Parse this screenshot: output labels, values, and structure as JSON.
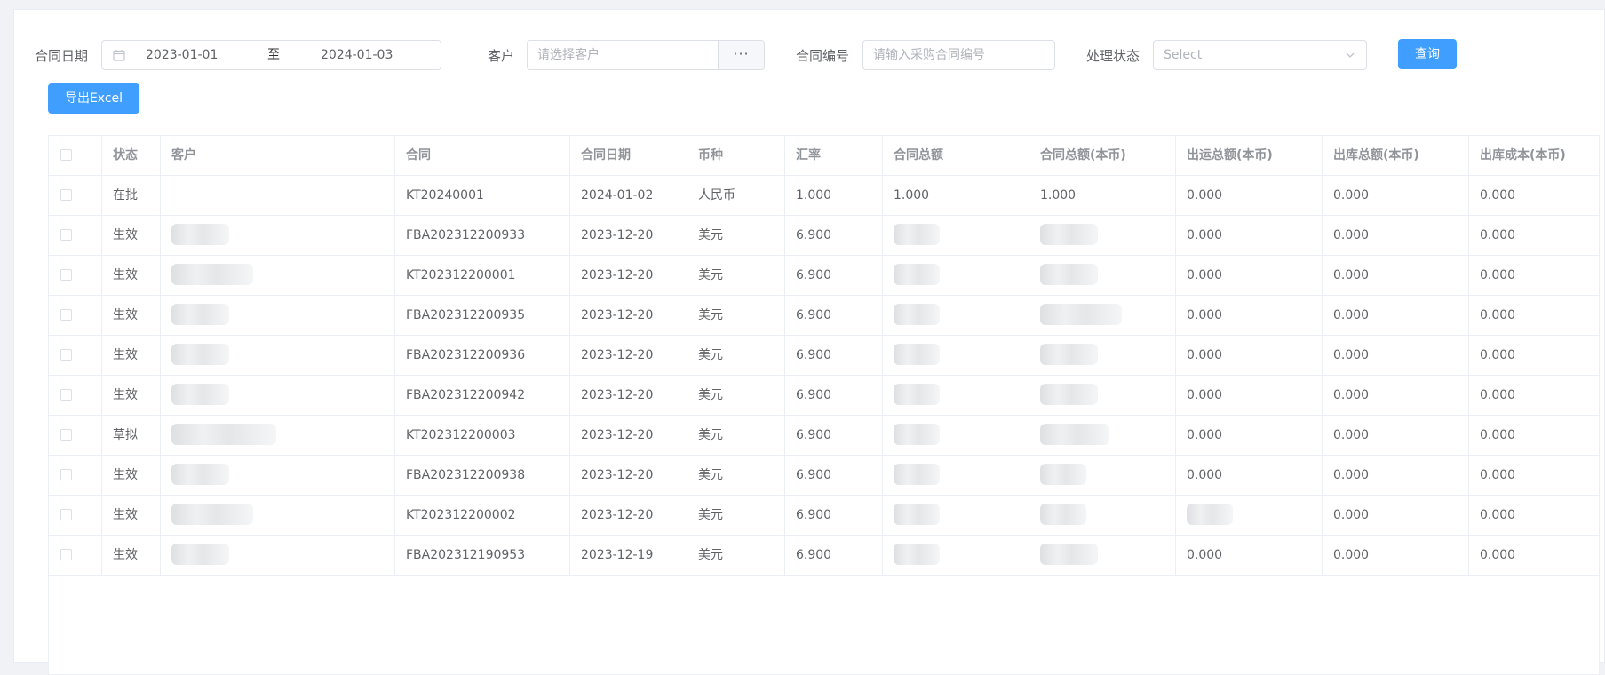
{
  "filters": {
    "date_label": "合同日期",
    "date_start": "2023-01-01",
    "date_sep": "至",
    "date_end": "2024-01-03",
    "customer_label": "客户",
    "customer_placeholder": "请选择客户",
    "customer_more": "···",
    "contract_label": "合同编号",
    "contract_placeholder": "请输入采购合同编号",
    "status_label": "处理状态",
    "status_placeholder": "Select",
    "query_label": "查询",
    "export_label": "导出Excel"
  },
  "table": {
    "headers": [
      "状态",
      "客户",
      "合同",
      "合同日期",
      "币种",
      "汇率",
      "合同总额",
      "合同总额(本币)",
      "出运总额(本币)",
      "出库总额(本币)",
      "出库成本(本币)"
    ],
    "rows": [
      {
        "status": "在批",
        "customer": "",
        "contract": "KT20240001",
        "date": "2024-01-02",
        "currency": "人民币",
        "rate": "1.000",
        "total": "1.000",
        "total_local": "1.000",
        "ship_total": "0.000",
        "out_total": "0.000",
        "out_cost": "0.000"
      },
      {
        "status": "生效",
        "customer": "",
        "contract": "FBA202312200933",
        "date": "2023-12-20",
        "currency": "美元",
        "rate": "6.900",
        "total": "",
        "total_local": "",
        "ship_total": "0.000",
        "out_total": "0.000",
        "out_cost": "0.000"
      },
      {
        "status": "生效",
        "customer": "",
        "contract": "KT202312200001",
        "date": "2023-12-20",
        "currency": "美元",
        "rate": "6.900",
        "total": "",
        "total_local": "",
        "ship_total": "0.000",
        "out_total": "0.000",
        "out_cost": "0.000"
      },
      {
        "status": "生效",
        "customer": "",
        "contract": "FBA202312200935",
        "date": "2023-12-20",
        "currency": "美元",
        "rate": "6.900",
        "total": "",
        "total_local": "",
        "ship_total": "0.000",
        "out_total": "0.000",
        "out_cost": "0.000"
      },
      {
        "status": "生效",
        "customer": "",
        "contract": "FBA202312200936",
        "date": "2023-12-20",
        "currency": "美元",
        "rate": "6.900",
        "total": "",
        "total_local": "",
        "ship_total": "0.000",
        "out_total": "0.000",
        "out_cost": "0.000"
      },
      {
        "status": "生效",
        "customer": "",
        "contract": "FBA202312200942",
        "date": "2023-12-20",
        "currency": "美元",
        "rate": "6.900",
        "total": "",
        "total_local": "",
        "ship_total": "0.000",
        "out_total": "0.000",
        "out_cost": "0.000"
      },
      {
        "status": "草拟",
        "customer": "",
        "contract": "KT202312200003",
        "date": "2023-12-20",
        "currency": "美元",
        "rate": "6.900",
        "total": "",
        "total_local": "",
        "ship_total": "0.000",
        "out_total": "0.000",
        "out_cost": "0.000"
      },
      {
        "status": "生效",
        "customer": "",
        "contract": "FBA202312200938",
        "date": "2023-12-20",
        "currency": "美元",
        "rate": "6.900",
        "total": "",
        "total_local": "",
        "ship_total": "0.000",
        "out_total": "0.000",
        "out_cost": "0.000"
      },
      {
        "status": "生效",
        "customer": "",
        "contract": "KT202312200002",
        "date": "2023-12-20",
        "currency": "美元",
        "rate": "6.900",
        "total": "",
        "total_local": "",
        "ship_total": "",
        "out_total": "0.000",
        "out_cost": "0.000"
      },
      {
        "status": "生效",
        "customer": "",
        "contract": "FBA202312190953",
        "date": "2023-12-19",
        "currency": "美元",
        "rate": "6.900",
        "total": "",
        "total_local": "",
        "ship_total": "0.000",
        "out_total": "0.000",
        "out_cost": "0.000"
      }
    ]
  }
}
